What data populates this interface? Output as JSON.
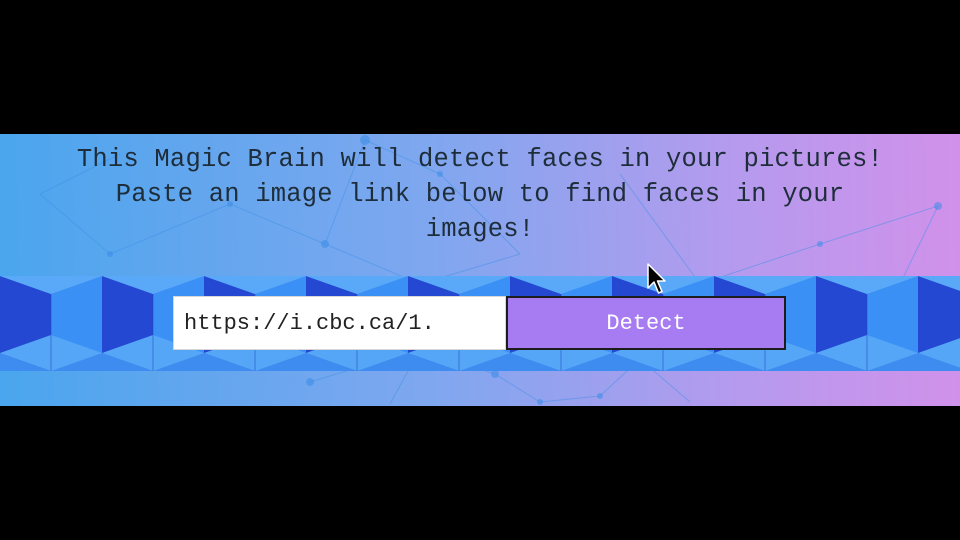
{
  "intro": {
    "line1": "This Magic Brain will detect faces in your pictures!",
    "line2": "Paste an image link below to find faces in your",
    "line3": "images!"
  },
  "form": {
    "url_value": "https://i.cbc.ca/1.",
    "detect_label": "Detect"
  },
  "colors": {
    "frame_background": "#000000",
    "gradient_left": "#4aa6ee",
    "gradient_right": "#d191ea",
    "band_light": "#3f8cf0",
    "band_dark": "#2249d4",
    "button": "#a77cf2",
    "text": "#1d2d3a"
  },
  "icons": {
    "cursor": "mouse-pointer-icon",
    "network": "network-pattern",
    "cubes": "isometric-cube-pattern"
  }
}
